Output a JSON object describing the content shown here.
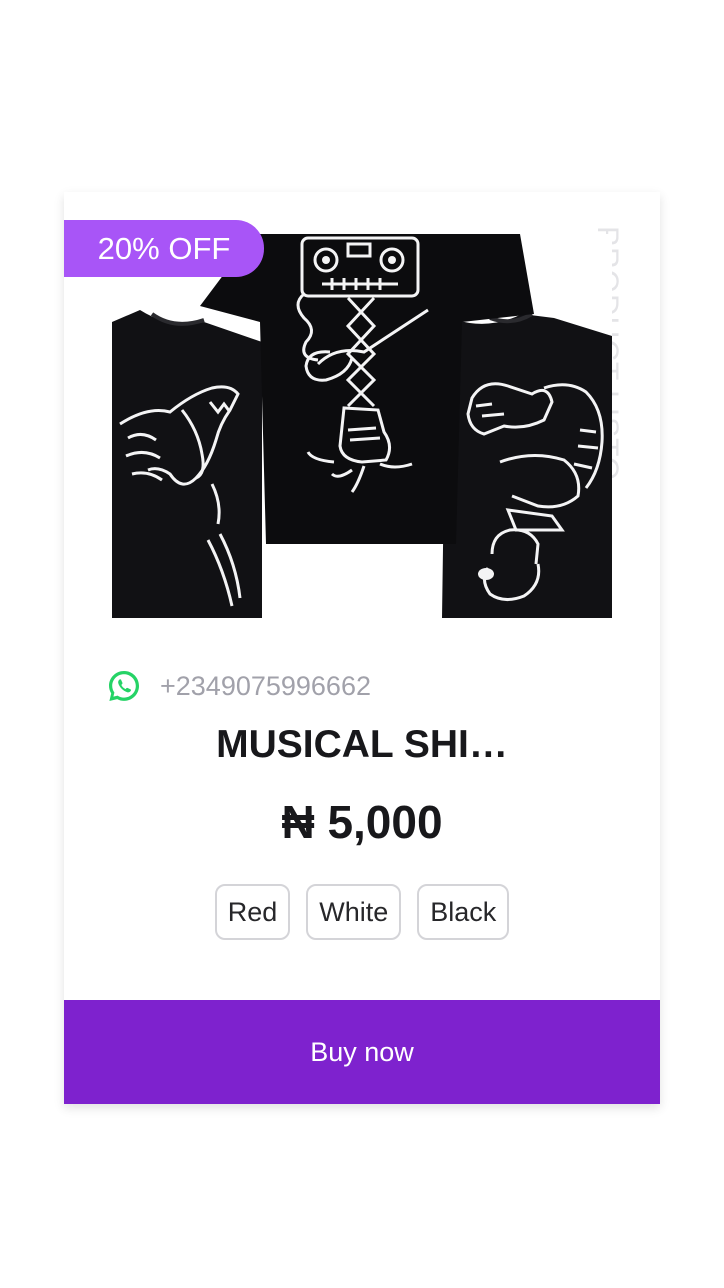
{
  "product": {
    "badge": "20% OFF",
    "side_label": "PRODUCT LISTO",
    "image_icon": "product-photo-three-black-tshirts",
    "phone": "+2349075996662",
    "phone_icon": "whatsapp-icon",
    "title": "MUSICAL SHI…",
    "price": "₦ 5,000",
    "variants": [
      "Red",
      "White",
      "Black"
    ],
    "buy_label": "Buy now"
  },
  "colors": {
    "accent": "#7e22ce",
    "badge": "#a855f7",
    "whatsapp": "#25d366",
    "text": "#18181b",
    "muted": "#a1a1aa"
  }
}
